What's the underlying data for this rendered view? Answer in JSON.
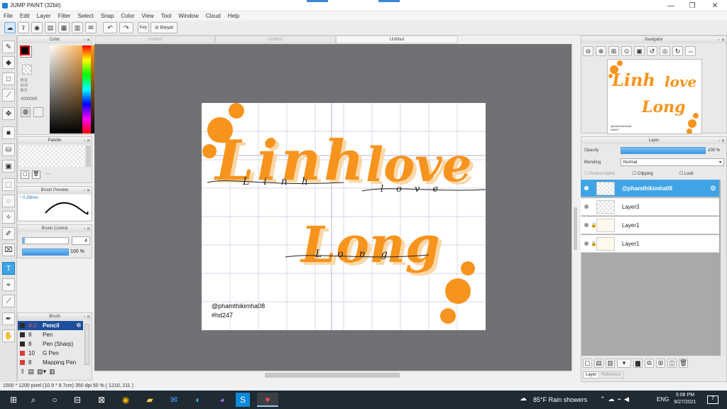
{
  "window": {
    "title": "JUMP PAINT (32bit)",
    "min": "—",
    "max": "❐",
    "close": "✕"
  },
  "menu": [
    "File",
    "Edit",
    "Layer",
    "Filter",
    "Select",
    "Snap",
    "Color",
    "View",
    "Tool",
    "Window",
    "Cloud",
    "Help"
  ],
  "toolbar": {
    "key_label": "Key",
    "reset_label": "Reset"
  },
  "tabs": [
    "Untitled",
    "Untitled",
    "Untitled"
  ],
  "color_panel": {
    "title": "Color",
    "r": "R:0",
    "g": "G:0",
    "b": "B:0",
    "hex": "#000000",
    "fg": "#000000",
    "bg": "#ffffff"
  },
  "palette_panel": {
    "title": "Palette",
    "empty": "---"
  },
  "brush_preview": {
    "title": "Brush Preview",
    "size": "* 0.29mm"
  },
  "brush_control": {
    "title": "Brush Control",
    "size": "4",
    "opacity": "100 %"
  },
  "brush_panel": {
    "title": "Brush",
    "items": [
      {
        "size": "4.0",
        "name": "Pencil",
        "color": "#2a2a2a"
      },
      {
        "size": "8",
        "name": "Pen",
        "color": "#2a2a2a"
      },
      {
        "size": "8",
        "name": "Pen (Sharp)",
        "color": "#2a2a2a"
      },
      {
        "size": "10",
        "name": "G Pen",
        "color": "#e03a3a"
      },
      {
        "size": "8",
        "name": "Mapping Pen",
        "color": "#e03a3a"
      }
    ]
  },
  "artwork": {
    "line1a": "Linh",
    "line1b": "love",
    "line2": "Long",
    "handwriting1": "Linh",
    "handwriting2": "love",
    "handwriting3": "Long",
    "credit": "@phamthikimha08",
    "tag": "#hd247",
    "accent": "#f7941d"
  },
  "navigator": {
    "title": "Navigator"
  },
  "layer_panel": {
    "title": "Layer",
    "opacity_label": "Opacity",
    "opacity_value": "100 %",
    "blending_label": "Blending",
    "blending_value": "Normal",
    "protect_alpha": "Protect Alpha",
    "clipping": "Clipping",
    "lock": "Lock",
    "layers": [
      {
        "name": "@phamthikimha08",
        "selected": true
      },
      {
        "name": "Layer3",
        "selected": false
      },
      {
        "name": "Layer1",
        "selected": false
      },
      {
        "name": "Layer1",
        "selected": false
      }
    ],
    "bottom_tabs": [
      "Layer",
      "Reference"
    ]
  },
  "status": "1500 * 1200 pixel  (10.9 * 8.7cm)  350 dpi  50 %  ( 1210, 211 )",
  "taskbar": {
    "weather": "85°F  Rain showers",
    "lang": "ENG",
    "time": "5:06 PM",
    "date": "9/27/2021",
    "notif": "7"
  }
}
